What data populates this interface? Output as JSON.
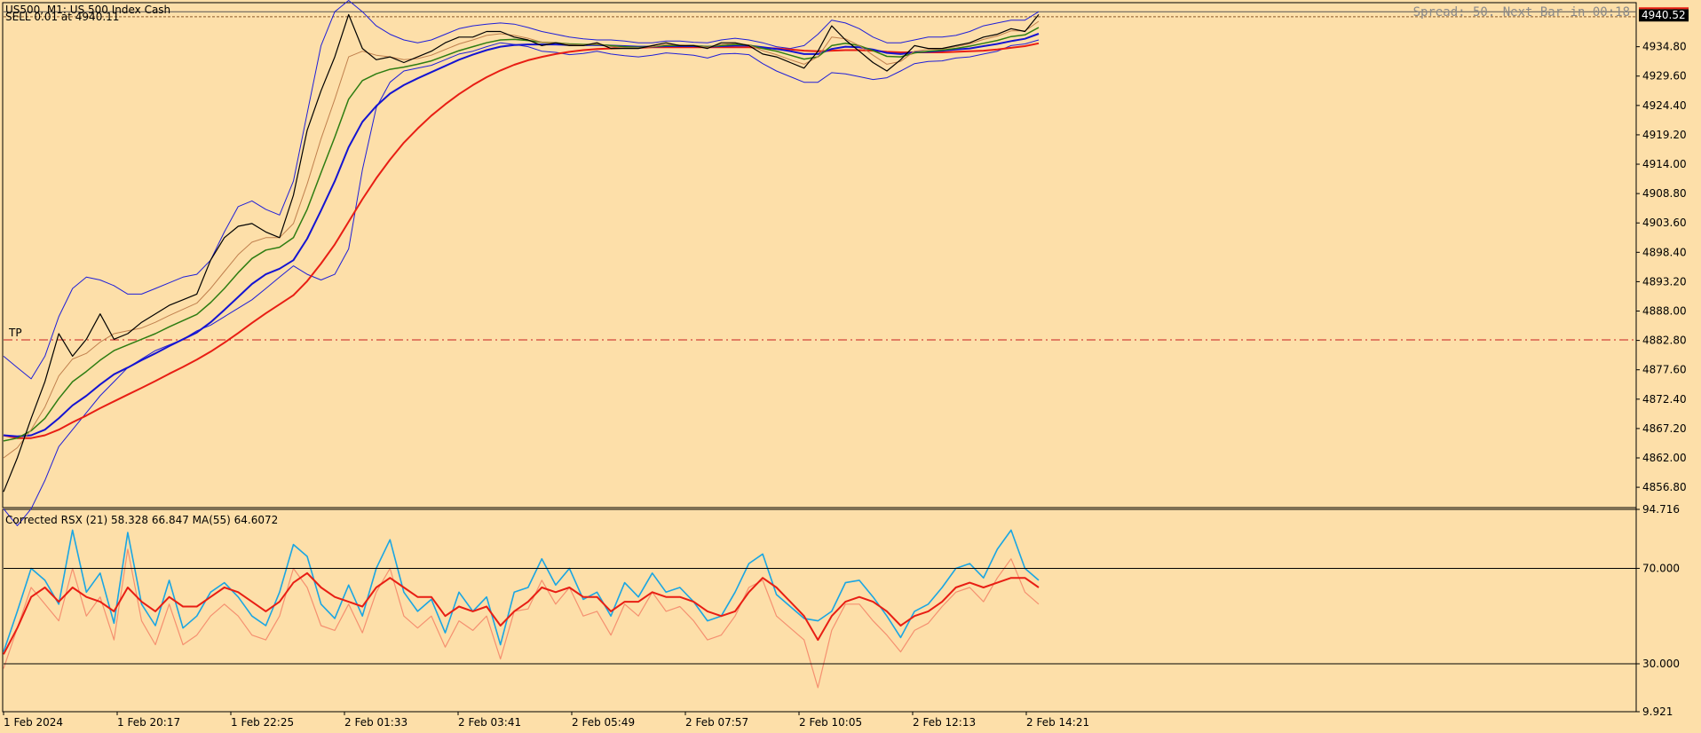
{
  "header": {
    "symbol_line": "US500, M1:  US 500 Index Cash",
    "sub_line": "SELL 0.01 at 4940.11",
    "spread_text": "Spread: 50. Next Bar in 00:18"
  },
  "price_tag": "4940.52",
  "tp_label": "TP",
  "indicator_label": "Corrected RSX (21) 58.328 66.847 MA(55) 64.6072",
  "colors": {
    "background": "#FDDFA9",
    "price": "#000000",
    "bollinger": "#1F1FD8",
    "ma_fast": "#C0804E",
    "ma_green": "#2E7D12",
    "ma_blue": "#1414D2",
    "ma_red": "#E81E14",
    "rsx_cyan": "#1AA6E3",
    "rsx_salmon": "#F59070",
    "rsx_red": "#E81E14",
    "tp_line": "#C81E1E"
  },
  "chart_data": [
    {
      "type": "line",
      "title": "US500, M1:  US 500 Index Cash",
      "ylim": [
        4853.2,
        4942.6
      ],
      "y_ticks": [
        "4934.80",
        "4929.60",
        "4924.40",
        "4919.20",
        "4914.00",
        "4908.80",
        "4903.60",
        "4898.40",
        "4893.20",
        "4888.00",
        "4882.80",
        "4877.60",
        "4872.40",
        "4867.20",
        "4862.00",
        "4856.80"
      ],
      "x_tick_labels": [
        "1 Feb 2024",
        "1 Feb 20:17",
        "1 Feb 22:25",
        "2 Feb 01:33",
        "2 Feb 03:41",
        "2 Feb 05:49",
        "2 Feb 07:57",
        "2 Feb 10:05",
        "2 Feb 12:13",
        "2 Feb 14:21"
      ],
      "last_price": 4940.52,
      "sell_price": 4940.11,
      "tp_price": 4882.9,
      "series": [
        {
          "key": "price",
          "values": [
            4856.0,
            4862.0,
            4869.0,
            4875.5,
            4884.0,
            4880.0,
            4883.0,
            4887.5,
            4883.0,
            4884.0,
            4886.0,
            4887.5,
            4889.0,
            4890.0,
            4891.0,
            4897.0,
            4901.0,
            4903.0,
            4903.5,
            4902.0,
            4901.0,
            4908.5,
            4920.0,
            4927.0,
            4933.0,
            4940.5,
            4934.5,
            4932.5,
            4933.0,
            4932.0,
            4933.0,
            4934.0,
            4935.5,
            4936.5,
            4936.5,
            4937.5,
            4937.5,
            4936.5,
            4936.0,
            4935.0,
            4935.5,
            4935.0,
            4935.0,
            4935.5,
            4934.5,
            4934.5,
            4934.5,
            4935.0,
            4935.5,
            4935.0,
            4935.0,
            4934.5,
            4935.5,
            4935.5,
            4935.0,
            4933.5,
            4933.0,
            4932.0,
            4931.0,
            4934.0,
            4938.5,
            4936.0,
            4934.0,
            4932.0,
            4930.5,
            4932.5,
            4935.0,
            4934.5,
            4934.5,
            4935.0,
            4935.5,
            4936.5,
            4937.0,
            4938.0,
            4937.5,
            4940.5
          ]
        },
        {
          "key": "ma_fast",
          "values": [
            4862.0,
            4863.8,
            4867.0,
            4871.0,
            4876.5,
            4879.5,
            4880.5,
            4882.5,
            4884.0,
            4884.5,
            4885.0,
            4886.0,
            4887.2,
            4888.3,
            4889.4,
            4892.0,
            4895.0,
            4898.0,
            4900.2,
            4901.0,
            4901.0,
            4903.5,
            4910.5,
            4918.5,
            4925.5,
            4933.0,
            4934.0,
            4933.3,
            4933.0,
            4932.5,
            4932.7,
            4933.3,
            4934.3,
            4935.3,
            4936.0,
            4936.8,
            4937.1,
            4936.8,
            4936.3,
            4935.6,
            4935.5,
            4935.2,
            4935.1,
            4935.3,
            4934.8,
            4934.6,
            4934.6,
            4934.8,
            4935.2,
            4935.1,
            4935.0,
            4934.7,
            4935.2,
            4935.4,
            4935.1,
            4934.1,
            4933.4,
            4932.5,
            4931.7,
            4933.0,
            4936.5,
            4936.2,
            4935.0,
            4933.3,
            4931.7,
            4932.2,
            4934.0,
            4934.3,
            4934.4,
            4934.8,
            4935.3,
            4936.1,
            4936.7,
            4937.6,
            4937.6,
            4939.3
          ]
        },
        {
          "key": "ma_green",
          "values": [
            4865.0,
            4865.5,
            4866.8,
            4869.0,
            4872.5,
            4875.5,
            4877.3,
            4879.3,
            4881.0,
            4882.0,
            4883.0,
            4884.0,
            4885.2,
            4886.3,
            4887.4,
            4889.5,
            4892.0,
            4894.8,
            4897.3,
            4898.8,
            4899.3,
            4901.0,
            4906.0,
            4912.5,
            4918.8,
            4925.5,
            4928.8,
            4930.0,
            4930.8,
            4931.2,
            4931.7,
            4932.3,
            4933.2,
            4934.1,
            4934.8,
            4935.5,
            4936.0,
            4936.1,
            4935.9,
            4935.6,
            4935.5,
            4935.3,
            4935.2,
            4935.2,
            4935.0,
            4934.8,
            4934.7,
            4934.8,
            4935.0,
            4935.0,
            4935.0,
            4934.8,
            4935.0,
            4935.2,
            4935.1,
            4934.5,
            4934.0,
            4933.3,
            4932.6,
            4933.0,
            4935.0,
            4935.4,
            4935.0,
            4934.1,
            4933.1,
            4933.0,
            4933.7,
            4934.0,
            4934.2,
            4934.5,
            4934.9,
            4935.4,
            4935.9,
            4936.6,
            4936.9,
            4938.2
          ]
        },
        {
          "key": "ma_blue",
          "values": [
            4866.0,
            4865.8,
            4866.0,
            4867.0,
            4869.0,
            4871.3,
            4873.0,
            4875.0,
            4876.8,
            4878.0,
            4879.3,
            4880.5,
            4881.8,
            4883.0,
            4884.2,
            4886.0,
            4888.2,
            4890.5,
            4892.8,
            4894.5,
            4895.5,
            4897.0,
            4900.8,
            4905.8,
            4911.0,
            4917.0,
            4921.5,
            4924.3,
            4926.5,
            4928.0,
            4929.2,
            4930.3,
            4931.4,
            4932.5,
            4933.4,
            4934.2,
            4934.8,
            4935.1,
            4935.2,
            4935.2,
            4935.2,
            4935.1,
            4935.1,
            4935.1,
            4935.0,
            4934.9,
            4934.8,
            4934.8,
            4934.9,
            4934.9,
            4934.9,
            4934.8,
            4934.9,
            4935.0,
            4935.0,
            4934.7,
            4934.4,
            4934.0,
            4933.5,
            4933.5,
            4934.4,
            4934.8,
            4934.7,
            4934.3,
            4933.7,
            4933.5,
            4933.8,
            4933.9,
            4934.1,
            4934.3,
            4934.5,
            4934.9,
            4935.3,
            4935.8,
            4936.2,
            4937.1
          ]
        },
        {
          "key": "ma_red",
          "values": [
            4866.0,
            4865.5,
            4865.5,
            4866.0,
            4867.0,
            4868.3,
            4869.5,
            4870.8,
            4872.0,
            4873.2,
            4874.4,
            4875.6,
            4876.9,
            4878.1,
            4879.4,
            4880.8,
            4882.4,
            4884.1,
            4885.9,
            4887.6,
            4889.2,
            4890.8,
            4893.3,
            4896.4,
            4899.8,
            4903.8,
            4907.8,
            4911.5,
            4914.8,
            4917.8,
            4920.3,
            4922.6,
            4924.6,
            4926.4,
            4928.0,
            4929.4,
            4930.6,
            4931.6,
            4932.4,
            4933.0,
            4933.5,
            4933.9,
            4934.2,
            4934.4,
            4934.5,
            4934.6,
            4934.6,
            4934.7,
            4934.7,
            4934.7,
            4934.7,
            4934.7,
            4934.7,
            4934.7,
            4934.7,
            4934.6,
            4934.5,
            4934.3,
            4934.1,
            4934.0,
            4934.1,
            4934.2,
            4934.2,
            4934.1,
            4933.9,
            4933.8,
            4933.8,
            4933.8,
            4933.8,
            4933.9,
            4934.0,
            4934.1,
            4934.3,
            4934.6,
            4934.9,
            4935.4
          ]
        },
        {
          "key": "bb_upper",
          "values": [
            4880.0,
            4878.0,
            4876.0,
            4880.0,
            4887.0,
            4892.0,
            4894.0,
            4893.5,
            4892.5,
            4891.0,
            4891.0,
            4892.0,
            4893.0,
            4894.0,
            4894.5,
            4897.0,
            4902.0,
            4906.5,
            4907.5,
            4906.0,
            4905.0,
            4911.0,
            4923.0,
            4935.0,
            4941.0,
            4943.0,
            4941.0,
            4938.5,
            4937.0,
            4936.0,
            4935.5,
            4936.0,
            4937.0,
            4938.0,
            4938.5,
            4938.8,
            4939.0,
            4938.8,
            4938.2,
            4937.5,
            4937.0,
            4936.5,
            4936.2,
            4936.0,
            4936.0,
            4935.8,
            4935.5,
            4935.5,
            4935.8,
            4935.8,
            4935.6,
            4935.5,
            4936.0,
            4936.3,
            4936.0,
            4935.5,
            4934.8,
            4934.5,
            4935.0,
            4937.0,
            4939.5,
            4939.0,
            4938.0,
            4936.5,
            4935.5,
            4935.5,
            4936.0,
            4936.5,
            4936.5,
            4936.8,
            4937.5,
            4938.5,
            4939.0,
            4939.5,
            4939.5,
            4941.0
          ]
        },
        {
          "key": "bb_lower",
          "values": [
            4853.0,
            4850.0,
            4853.0,
            4858.0,
            4864.0,
            4867.0,
            4870.0,
            4873.0,
            4875.5,
            4878.0,
            4879.5,
            4881.0,
            4882.0,
            4883.0,
            4884.5,
            4885.5,
            4887.0,
            4888.5,
            4890.0,
            4892.0,
            4894.0,
            4896.0,
            4894.5,
            4893.5,
            4894.5,
            4899.0,
            4913.0,
            4924.0,
            4928.5,
            4930.5,
            4931.0,
            4931.5,
            4932.5,
            4933.5,
            4934.0,
            4934.8,
            4935.5,
            4935.2,
            4934.8,
            4934.0,
            4933.8,
            4933.4,
            4933.6,
            4934.0,
            4933.5,
            4933.2,
            4933.0,
            4933.3,
            4933.7,
            4933.5,
            4933.3,
            4932.8,
            4933.5,
            4933.6,
            4933.4,
            4931.8,
            4930.5,
            4929.5,
            4928.5,
            4928.5,
            4930.2,
            4930.0,
            4929.5,
            4929.0,
            4929.3,
            4930.5,
            4931.8,
            4932.2,
            4932.3,
            4932.8,
            4933.0,
            4933.5,
            4934.0,
            4935.0,
            4935.3,
            4936.0
          ]
        }
      ]
    },
    {
      "type": "line",
      "title": "Corrected RSX (21) 58.328 66.847 MA(55) 64.6072",
      "ylim": [
        9.921,
        94.716
      ],
      "y_ticks": [
        "94.716",
        "70.000",
        "30.000",
        "9.921"
      ],
      "levels": [
        70,
        30
      ],
      "series": [
        {
          "key": "rsx_cyan",
          "values": [
            35,
            52,
            70,
            65,
            55,
            86,
            60,
            68,
            47,
            85,
            55,
            46,
            65,
            45,
            50,
            60,
            64,
            58,
            50,
            46,
            60,
            80,
            75,
            55,
            49,
            63,
            50,
            70,
            82,
            60,
            52,
            57,
            43,
            60,
            52,
            58,
            38,
            60,
            62,
            74,
            63,
            70,
            57,
            60,
            50,
            64,
            58,
            68,
            60,
            62,
            56,
            48,
            50,
            60,
            72,
            76,
            59,
            54,
            49,
            48,
            52,
            64,
            65,
            58,
            50,
            41,
            52,
            55,
            62,
            70,
            72,
            66,
            78,
            86,
            70,
            65
          ]
        },
        {
          "key": "rsx_salmon",
          "values": [
            28,
            45,
            62,
            55,
            48,
            70,
            50,
            58,
            40,
            78,
            48,
            38,
            55,
            38,
            42,
            50,
            55,
            50,
            42,
            40,
            50,
            70,
            62,
            46,
            44,
            55,
            43,
            60,
            70,
            50,
            45,
            50,
            37,
            48,
            44,
            50,
            32,
            52,
            53,
            65,
            55,
            62,
            50,
            52,
            42,
            55,
            50,
            60,
            52,
            54,
            48,
            40,
            42,
            50,
            62,
            65,
            50,
            45,
            40,
            20,
            44,
            55,
            55,
            48,
            42,
            35,
            44,
            47,
            54,
            60,
            62,
            56,
            66,
            74,
            60,
            55
          ]
        },
        {
          "key": "rsx_red",
          "values": [
            34,
            45,
            58,
            62,
            56,
            62,
            58,
            56,
            52,
            62,
            56,
            52,
            58,
            54,
            54,
            58,
            62,
            60,
            56,
            52,
            56,
            64,
            68,
            62,
            58,
            56,
            54,
            62,
            66,
            62,
            58,
            58,
            50,
            54,
            52,
            54,
            46,
            52,
            56,
            62,
            60,
            62,
            58,
            58,
            52,
            56,
            56,
            60,
            58,
            58,
            56,
            52,
            50,
            52,
            60,
            66,
            62,
            56,
            50,
            40,
            50,
            56,
            58,
            56,
            52,
            46,
            50,
            52,
            56,
            62,
            64,
            62,
            64,
            66,
            66,
            62
          ]
        }
      ]
    }
  ]
}
